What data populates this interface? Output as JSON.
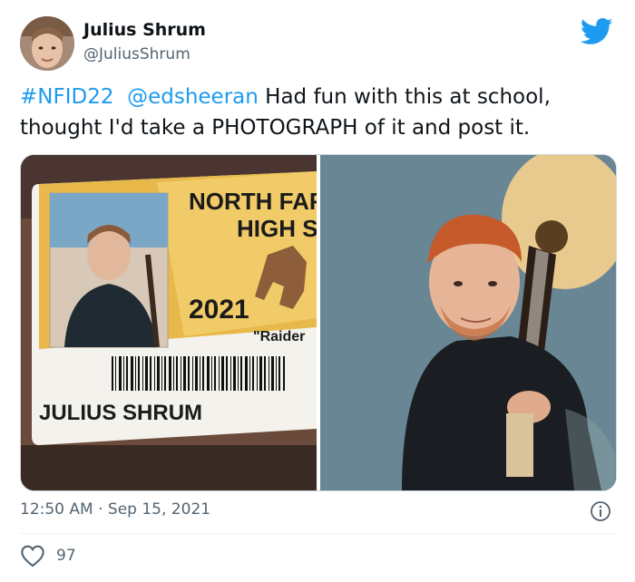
{
  "author": {
    "name": "Julius Shrum",
    "handle": "@JuliusShrum"
  },
  "tweet": {
    "hashtag": "#NFID22",
    "mention": "@edsheeran",
    "text": " Had fun with this at school, thought I'd take a PHOTOGRAPH of it and post it."
  },
  "media": {
    "id_card": {
      "school_line1": "NORTH FAR",
      "school_line2": "HIGH SC",
      "year": "2021",
      "mascot": "\"Raider",
      "student_name": "JULIUS SHRUM"
    }
  },
  "meta": {
    "time": "12:50 AM",
    "separator": "·",
    "date": "Sep 15, 2021"
  },
  "likes": {
    "count": "97"
  },
  "colors": {
    "accent": "#1d9bf0",
    "text": "#0f1419",
    "secondary": "#536471"
  }
}
